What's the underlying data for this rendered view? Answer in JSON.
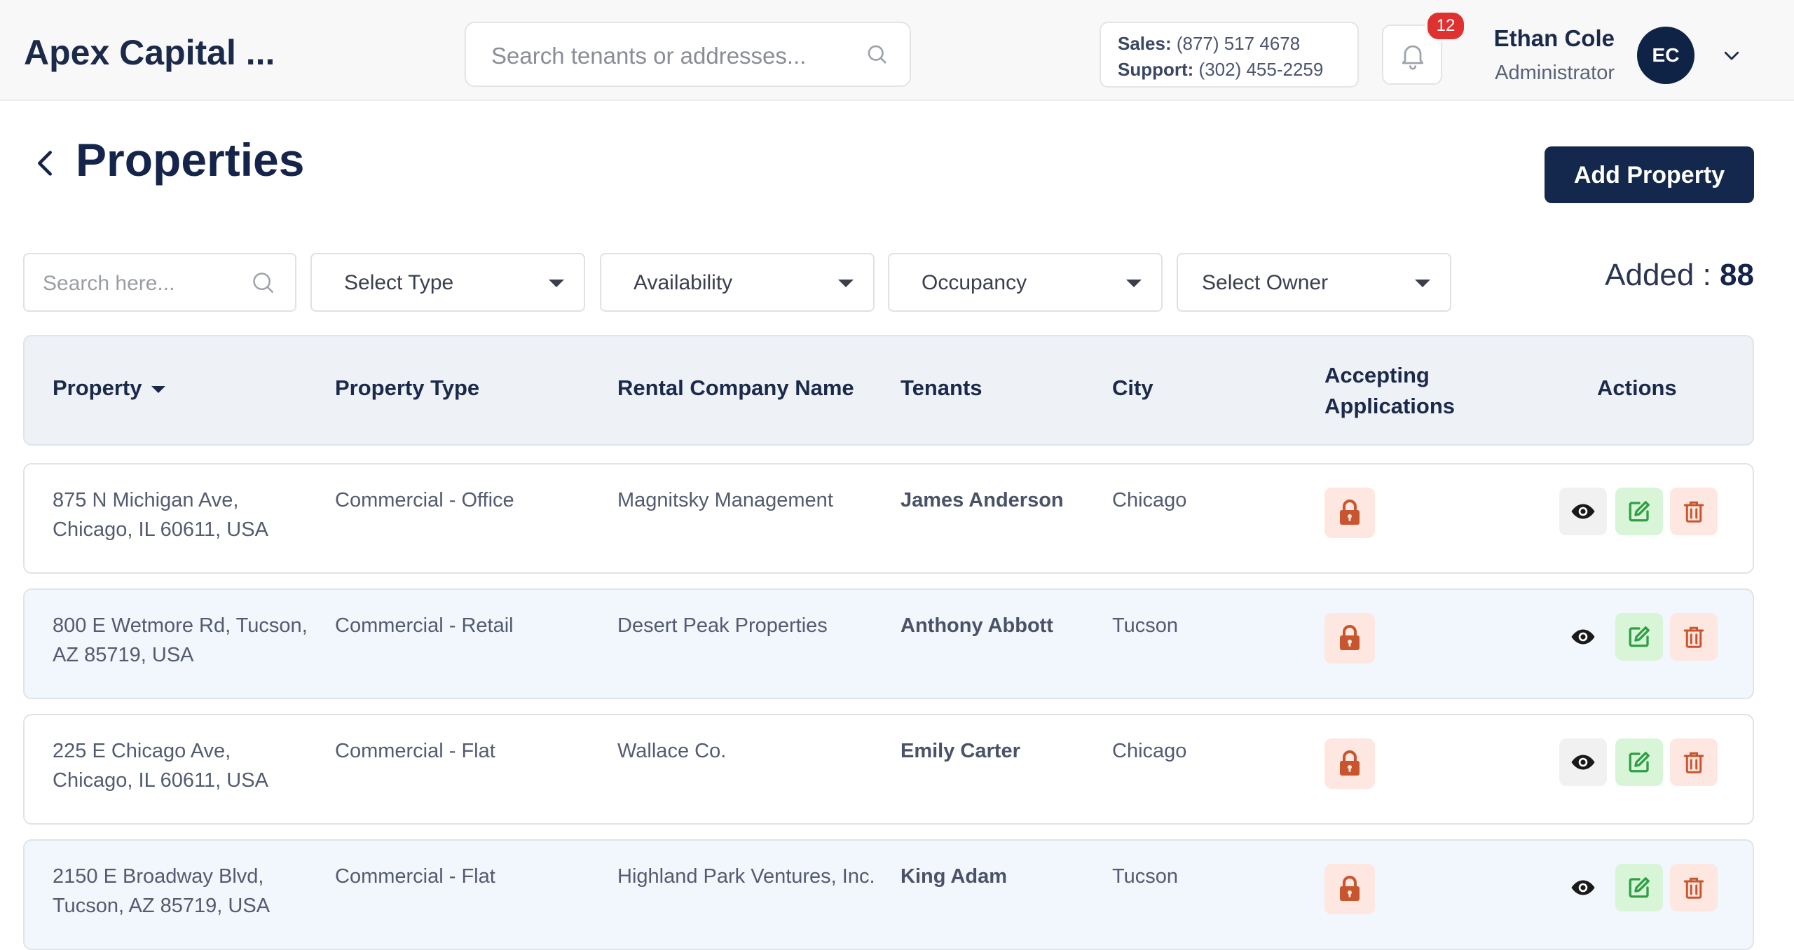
{
  "header": {
    "brand": "Apex Capital ...",
    "search_placeholder": "Search tenants or addresses...",
    "sales_label": "Sales:",
    "sales_phone": "(877) 517 4678",
    "support_label": "Support:",
    "support_phone": "(302) 455-2259",
    "notification_count": "12",
    "user_name": "Ethan Cole",
    "user_role": "Administrator",
    "avatar_initials": "EC"
  },
  "page": {
    "title": "Properties",
    "add_button": "Add Property"
  },
  "filters": {
    "search_placeholder": "Search here...",
    "type": "Select Type",
    "availability": "Availability",
    "occupancy": "Occupancy",
    "owner": "Select Owner",
    "added_label": "Added :",
    "added_count": "88"
  },
  "table": {
    "columns": [
      "Property",
      "Property Type",
      "Rental Company Name",
      "Tenants",
      "City",
      "Accepting Applications",
      "Actions"
    ],
    "rows": [
      {
        "address_line1": "875 N Michigan Ave,",
        "address_line2": "Chicago, IL 60611, USA",
        "type": "Commercial - Office",
        "company": "Magnitsky Management",
        "tenant": "James Anderson",
        "city": "Chicago"
      },
      {
        "address_line1": "800 E Wetmore Rd, Tucson,",
        "address_line2": "AZ 85719, USA",
        "type": "Commercial - Retail",
        "company": "Desert Peak Properties",
        "tenant": "Anthony Abbott",
        "city": "Tucson"
      },
      {
        "address_line1": "225 E Chicago Ave,",
        "address_line2": "Chicago, IL 60611, USA",
        "type": "Commercial - Flat",
        "company": "Wallace Co.",
        "tenant": "Emily Carter",
        "city": "Chicago"
      },
      {
        "address_line1": "2150 E Broadway Blvd,",
        "address_line2": "Tucson, AZ 85719, USA",
        "type": "Commercial - Flat",
        "company": "Highland Park Ventures, Inc.",
        "tenant": "King Adam",
        "city": "Tucson"
      }
    ]
  },
  "colors": {
    "primary": "#14284e",
    "lock": "#c8552d",
    "edit": "#2f9e44",
    "delete": "#c8552d",
    "badge": "#e03131"
  }
}
